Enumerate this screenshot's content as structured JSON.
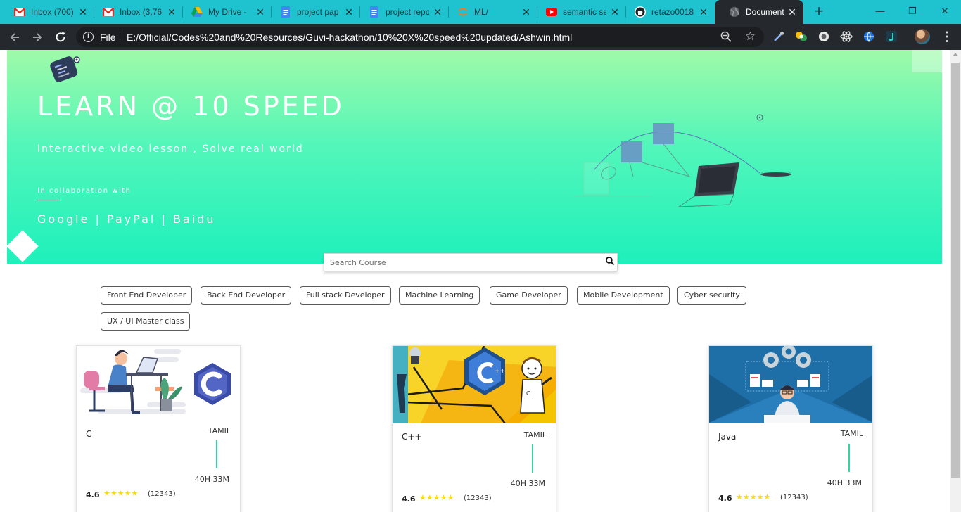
{
  "browser": {
    "tabs": [
      {
        "title": "Inbox (700)",
        "icon": "gmail-icon",
        "active": false
      },
      {
        "title": "Inbox (3,76",
        "icon": "gmail-icon",
        "active": false
      },
      {
        "title": "My Drive - ",
        "icon": "google-drive-icon",
        "active": false
      },
      {
        "title": "project pap",
        "icon": "google-docs-icon",
        "active": false
      },
      {
        "title": "project repo",
        "icon": "google-docs-icon",
        "active": false
      },
      {
        "title": "ML/",
        "icon": "jupyter-icon",
        "active": false
      },
      {
        "title": "semantic se",
        "icon": "youtube-icon",
        "active": false
      },
      {
        "title": "retazo0018",
        "icon": "github-icon",
        "active": false
      },
      {
        "title": "Document",
        "icon": "globe-icon",
        "active": true
      }
    ],
    "new_tab_symbol": "+",
    "window_controls": {
      "minimize": "—",
      "restore": "❐",
      "close": "✕"
    },
    "omnibox": {
      "scheme_label": "File",
      "url": "E:/Official/Codes%20and%20Resources/Guvi-hackathon/10%20X%20speed%20updated/Ashwin.html"
    },
    "colors": {
      "tabstrip": "#1fc2cf",
      "toolbar": "#25292e"
    }
  },
  "hero": {
    "title": "LEARN @ 10 SPEED",
    "subtitle": "Interactive video lesson , Solve real world",
    "collab_label": "In collaboration with",
    "partners": "Google | PayPal | Baidu",
    "colors": {
      "top": "#9ffaa8",
      "bottom": "#1ef0bb"
    }
  },
  "search": {
    "placeholder": "Search Course",
    "icon": "search-icon"
  },
  "categories": [
    "Front End Developer",
    "Back End Developer",
    "Full stack Developer",
    "Machine Learning",
    "Game Developer",
    "Mobile Development",
    "Cyber security",
    "UX / UI Master class"
  ],
  "courses": [
    {
      "name": "C",
      "language": "TAMIL",
      "duration": "40H 33M",
      "rating": "4.6",
      "stars": "★★★★★",
      "reviews": "(12343)",
      "image": "c-language-illustration"
    },
    {
      "name": "C++",
      "language": "TAMIL",
      "duration": "40H 33M",
      "rating": "4.6",
      "stars": "★★★★★",
      "reviews": "(12343)",
      "image": "cpp-illustration"
    },
    {
      "name": "Java",
      "language": "TAMIL",
      "duration": "40H 33M",
      "rating": "4.6",
      "stars": "★★★★★",
      "reviews": "(12343)",
      "image": "java-developer-illustration"
    }
  ]
}
